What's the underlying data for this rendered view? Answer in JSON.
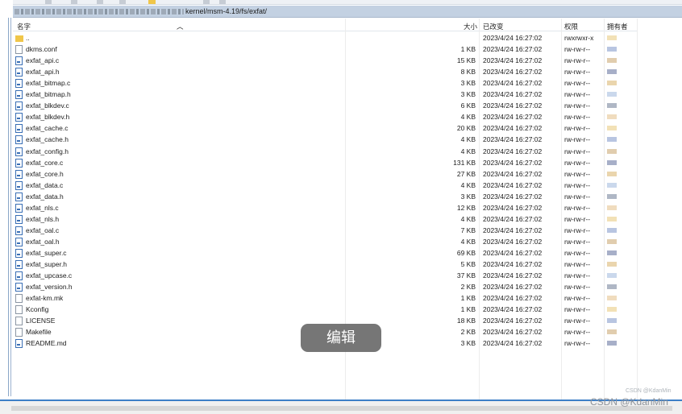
{
  "path": {
    "visible_text": "kernel/msm-4.19/fs/exfat/"
  },
  "columns": {
    "name": "名字",
    "size": "大小",
    "modified": "已改变",
    "permissions": "权限",
    "owner": "拥有者"
  },
  "files": [
    {
      "name": "..",
      "size": "",
      "date": "2023/4/24 16:27:02",
      "perm": "rwxrwxr-x",
      "type": "up"
    },
    {
      "name": "dkms.conf",
      "size": "1 KB",
      "date": "2023/4/24 16:27:02",
      "perm": "rw-rw-r--",
      "type": "file"
    },
    {
      "name": "exfat_api.c",
      "size": "15 KB",
      "date": "2023/4/24 16:27:02",
      "perm": "rw-rw-r--",
      "type": "c"
    },
    {
      "name": "exfat_api.h",
      "size": "8 KB",
      "date": "2023/4/24 16:27:02",
      "perm": "rw-rw-r--",
      "type": "c"
    },
    {
      "name": "exfat_bitmap.c",
      "size": "3 KB",
      "date": "2023/4/24 16:27:02",
      "perm": "rw-rw-r--",
      "type": "c"
    },
    {
      "name": "exfat_bitmap.h",
      "size": "3 KB",
      "date": "2023/4/24 16:27:02",
      "perm": "rw-rw-r--",
      "type": "c"
    },
    {
      "name": "exfat_blkdev.c",
      "size": "6 KB",
      "date": "2023/4/24 16:27:02",
      "perm": "rw-rw-r--",
      "type": "c"
    },
    {
      "name": "exfat_blkdev.h",
      "size": "4 KB",
      "date": "2023/4/24 16:27:02",
      "perm": "rw-rw-r--",
      "type": "c"
    },
    {
      "name": "exfat_cache.c",
      "size": "20 KB",
      "date": "2023/4/24 16:27:02",
      "perm": "rw-rw-r--",
      "type": "c"
    },
    {
      "name": "exfat_cache.h",
      "size": "4 KB",
      "date": "2023/4/24 16:27:02",
      "perm": "rw-rw-r--",
      "type": "c"
    },
    {
      "name": "exfat_config.h",
      "size": "4 KB",
      "date": "2023/4/24 16:27:02",
      "perm": "rw-rw-r--",
      "type": "c"
    },
    {
      "name": "exfat_core.c",
      "size": "131 KB",
      "date": "2023/4/24 16:27:02",
      "perm": "rw-rw-r--",
      "type": "c"
    },
    {
      "name": "exfat_core.h",
      "size": "27 KB",
      "date": "2023/4/24 16:27:02",
      "perm": "rw-rw-r--",
      "type": "c"
    },
    {
      "name": "exfat_data.c",
      "size": "4 KB",
      "date": "2023/4/24 16:27:02",
      "perm": "rw-rw-r--",
      "type": "c"
    },
    {
      "name": "exfat_data.h",
      "size": "3 KB",
      "date": "2023/4/24 16:27:02",
      "perm": "rw-rw-r--",
      "type": "c"
    },
    {
      "name": "exfat_nls.c",
      "size": "12 KB",
      "date": "2023/4/24 16:27:02",
      "perm": "rw-rw-r--",
      "type": "c"
    },
    {
      "name": "exfat_nls.h",
      "size": "4 KB",
      "date": "2023/4/24 16:27:02",
      "perm": "rw-rw-r--",
      "type": "c"
    },
    {
      "name": "exfat_oal.c",
      "size": "7 KB",
      "date": "2023/4/24 16:27:02",
      "perm": "rw-rw-r--",
      "type": "c"
    },
    {
      "name": "exfat_oal.h",
      "size": "4 KB",
      "date": "2023/4/24 16:27:02",
      "perm": "rw-rw-r--",
      "type": "c"
    },
    {
      "name": "exfat_super.c",
      "size": "69 KB",
      "date": "2023/4/24 16:27:02",
      "perm": "rw-rw-r--",
      "type": "c"
    },
    {
      "name": "exfat_super.h",
      "size": "5 KB",
      "date": "2023/4/24 16:27:02",
      "perm": "rw-rw-r--",
      "type": "c"
    },
    {
      "name": "exfat_upcase.c",
      "size": "37 KB",
      "date": "2023/4/24 16:27:02",
      "perm": "rw-rw-r--",
      "type": "c"
    },
    {
      "name": "exfat_version.h",
      "size": "2 KB",
      "date": "2023/4/24 16:27:02",
      "perm": "rw-rw-r--",
      "type": "c"
    },
    {
      "name": "exfat-km.mk",
      "size": "1 KB",
      "date": "2023/4/24 16:27:02",
      "perm": "rw-rw-r--",
      "type": "file"
    },
    {
      "name": "Kconfig",
      "size": "1 KB",
      "date": "2023/4/24 16:27:02",
      "perm": "rw-rw-r--",
      "type": "file"
    },
    {
      "name": "LICENSE",
      "size": "18 KB",
      "date": "2023/4/24 16:27:02",
      "perm": "rw-rw-r--",
      "type": "file"
    },
    {
      "name": "Makefile",
      "size": "2 KB",
      "date": "2023/4/24 16:27:02",
      "perm": "rw-rw-r--",
      "type": "file"
    },
    {
      "name": "README.md",
      "size": "3 KB",
      "date": "2023/4/24 16:27:02",
      "perm": "rw-rw-r--",
      "type": "c"
    }
  ],
  "tooltip": "编辑",
  "watermark": {
    "small": "CSDN @KdanMin",
    "large": "CSDN @KdanMin"
  },
  "colors": {
    "accent": "#3d7fc7",
    "pathbar": "#c3d1e2",
    "tooltip_bg": "#6f6f6f"
  }
}
